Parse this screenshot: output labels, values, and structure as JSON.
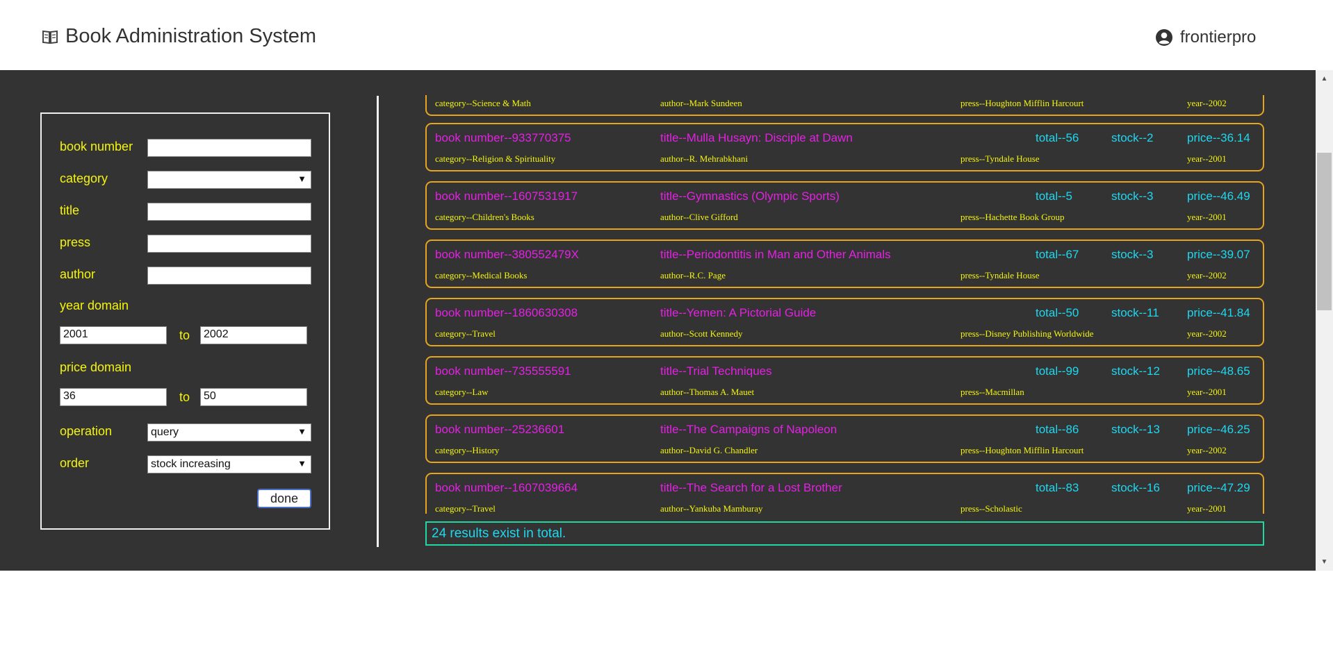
{
  "header": {
    "title": "Book Administration System",
    "username": "frontierpro"
  },
  "filter": {
    "book_number_label": "book number",
    "book_number_value": "",
    "category_label": "category",
    "category_value": "",
    "title_label": "title",
    "title_value": "",
    "press_label": "press",
    "press_value": "",
    "author_label": "author",
    "author_value": "",
    "year_label": "year domain",
    "year_from": "2001",
    "year_to": "2002",
    "price_label": "price domain",
    "price_from": "36",
    "price_to": "50",
    "to_label": "to",
    "operation_label": "operation",
    "operation_value": "query",
    "order_label": "order",
    "order_value": "stock increasing",
    "done_label": "done"
  },
  "results": [
    {
      "book_number": "",
      "title": "",
      "total": "",
      "stock": "",
      "price": "",
      "category": "category--Science & Math",
      "author": "author--Mark Sundeen",
      "press": "press--Houghton Mifflin Harcourt",
      "year": "year--2002"
    },
    {
      "book_number": "book number--933770375",
      "title": "title--Mulla Husayn: Disciple at Dawn",
      "total": "total--56",
      "stock": "stock--2",
      "price": "price--36.14",
      "category": "category--Religion & Spirituality",
      "author": "author--R. Mehrabkhani",
      "press": "press--Tyndale House",
      "year": "year--2001"
    },
    {
      "book_number": "book number--1607531917",
      "title": "title--Gymnastics (Olympic Sports)",
      "total": "total--5",
      "stock": "stock--3",
      "price": "price--46.49",
      "category": "category--Children's Books",
      "author": "author--Clive Gifford",
      "press": "press--Hachette Book Group",
      "year": "year--2001"
    },
    {
      "book_number": "book number--380552479X",
      "title": "title--Periodontitis in Man and Other Animals",
      "total": "total--67",
      "stock": "stock--3",
      "price": "price--39.07",
      "category": "category--Medical Books",
      "author": "author--R.C. Page",
      "press": "press--Tyndale House",
      "year": "year--2002"
    },
    {
      "book_number": "book number--1860630308",
      "title": "title--Yemen: A Pictorial Guide",
      "total": "total--50",
      "stock": "stock--11",
      "price": "price--41.84",
      "category": "category--Travel",
      "author": "author--Scott Kennedy",
      "press": "press--Disney Publishing Worldwide",
      "year": "year--2002"
    },
    {
      "book_number": "book number--735555591",
      "title": "title--Trial Techniques",
      "total": "total--99",
      "stock": "stock--12",
      "price": "price--48.65",
      "category": "category--Law",
      "author": "author--Thomas A. Mauet",
      "press": "press--Macmillan",
      "year": "year--2001"
    },
    {
      "book_number": "book number--25236601",
      "title": "title--The Campaigns of Napoleon",
      "total": "total--86",
      "stock": "stock--13",
      "price": "price--46.25",
      "category": "category--History",
      "author": "author--David G. Chandler",
      "press": "press--Houghton Mifflin Harcourt",
      "year": "year--2002"
    },
    {
      "book_number": "book number--1607039664",
      "title": "title--The Search for a Lost Brother",
      "total": "total--83",
      "stock": "stock--16",
      "price": "price--47.29",
      "category": "category--Travel",
      "author": "author--Yankuba Mamburay",
      "press": "press--Scholastic",
      "year": "year--2001"
    }
  ],
  "summary": "24 results exist in total.",
  "colors": {
    "background": "#333333",
    "accent_yellow": "#f5f50a",
    "accent_magenta": "#e520e5",
    "accent_cyan": "#1ed8f0",
    "card_border": "#e7a51f",
    "summary_border": "#21d7a2"
  },
  "icons": {
    "brand": "book-icon",
    "user": "user-circle-icon",
    "dropdown": "caret-down-icon"
  }
}
